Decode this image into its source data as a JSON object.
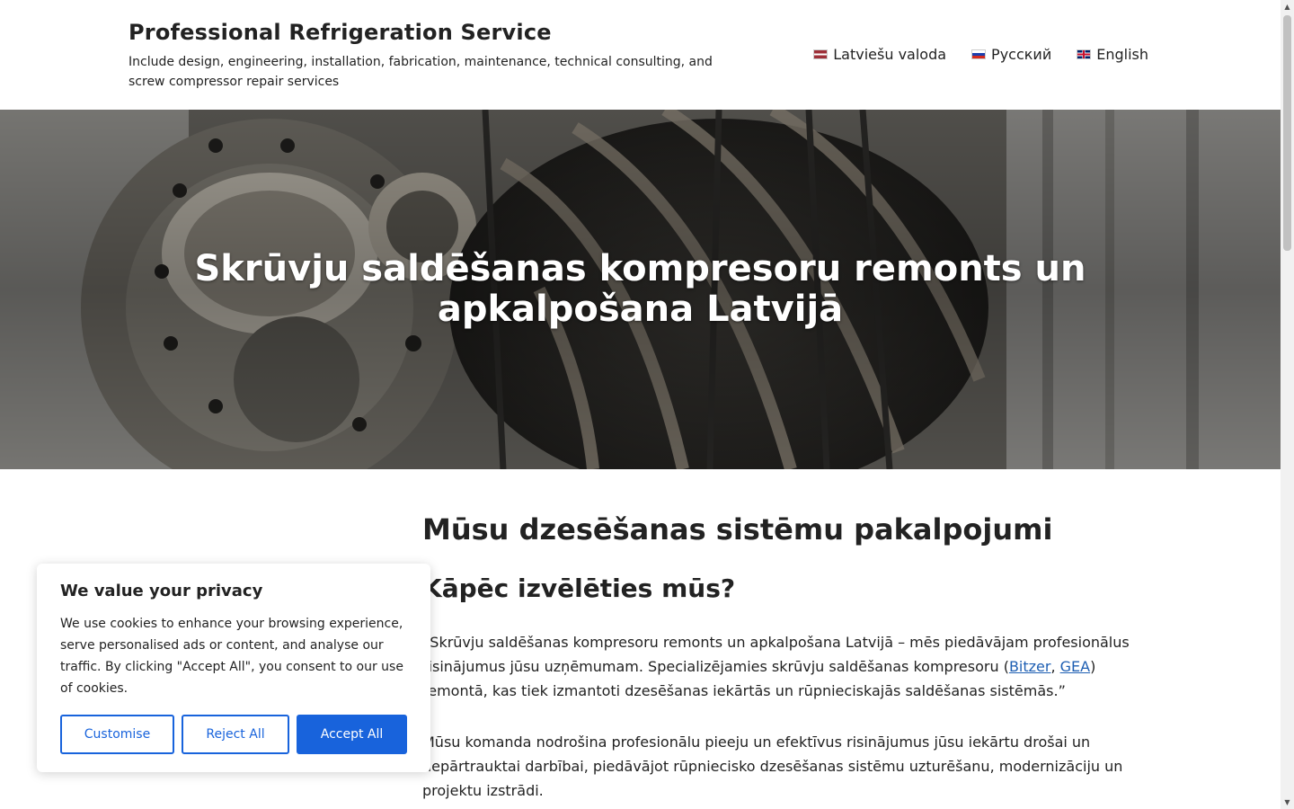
{
  "header": {
    "site_title": "Professional Refrigeration Service",
    "site_description": "Include design, engineering, installation, fabrication, maintenance, technical consulting, and screw compressor repair services",
    "languages": [
      {
        "label": "Latviešu valoda",
        "flag": "flag-latvia-icon"
      },
      {
        "label": "Русский",
        "flag": "flag-russia-icon"
      },
      {
        "label": "English",
        "flag": "flag-uk-icon"
      }
    ]
  },
  "hero": {
    "title": "Skrūvju saldēšanas kompresoru remonts un apkalpošana Latvijā"
  },
  "main": {
    "heading": "Mūsu dzesēšanas sistēmu pakalpojumi",
    "subheading": "Kāpēc izvēlēties mūs?",
    "para1_before": "“Skrūvju saldēšanas kompresoru remonts un apkalpošana Latvijā – mēs piedāvājam profesionālus risinājumus jūsu uzņēmumam. Specializējamies skrūvju saldēšanas kompresoru (",
    "link_bitzer": "Bitzer",
    "link_sep": ", ",
    "link_gea": "GEA",
    "para1_after": ") remontā, kas tiek izmantoti dzesēšanas iekārtās un rūpnieciskajās saldēšanas sistēmās.”",
    "para2": "Mūsu komanda nodrošina profesionālu pieeju un efektīvus risinājumus jūsu iekārtu drošai un nepārtrauktai darbībai, piedāvājot rūpniecisko dzesēšanas sistēmu uzturēšanu, modernizāciju un projektu izstrādi."
  },
  "cookie_banner": {
    "title": "We value your privacy",
    "text": "We use cookies to enhance your browsing experience, serve personalised ads or content, and analyse our traffic. By clicking \"Accept All\", you consent to our use of cookies.",
    "customise_label": "Customise",
    "reject_label": "Reject All",
    "accept_label": "Accept All"
  },
  "colors": {
    "accent": "#1863dc",
    "link": "#1e5fb3",
    "text": "#222222"
  }
}
